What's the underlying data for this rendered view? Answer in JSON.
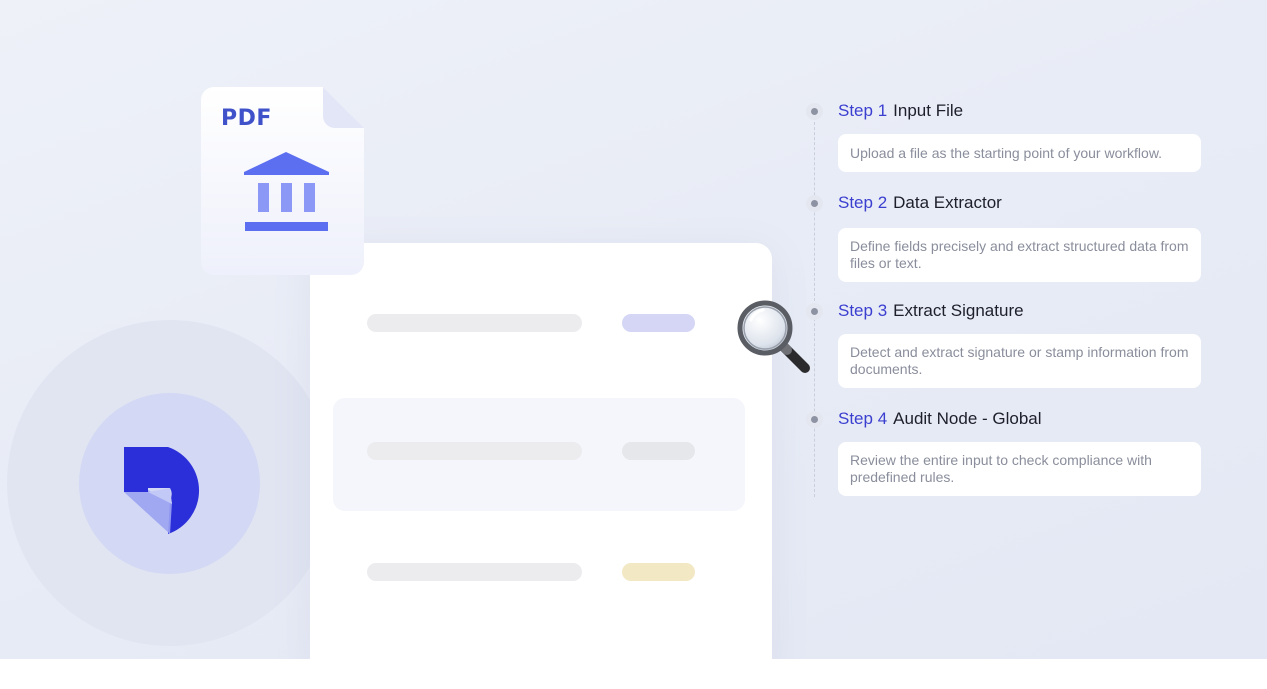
{
  "document": {
    "type_label": "PDF",
    "icon": "bank-building-icon"
  },
  "logo": {
    "icon": "brand-logo-icon"
  },
  "magnifier": {
    "icon": "magnifying-glass-icon"
  },
  "steps": [
    {
      "number": "Step 1",
      "name": "Input File",
      "description": "Upload a file as the starting point of your workflow."
    },
    {
      "number": "Step 2",
      "name": "Data Extractor",
      "description": "Define fields precisely and extract structured data from files or text."
    },
    {
      "number": "Step 3",
      "name": "Extract Signature",
      "description": "Detect and extract signature or stamp information from documents."
    },
    {
      "number": "Step 4",
      "name": "Audit Node - Global",
      "description": "Review the entire input to check compliance with predefined rules."
    }
  ],
  "colors": {
    "accent": "#3b3fd0",
    "brand_logo": "#2b2fd9",
    "pdf_label": "#3f52c9",
    "bank_icon": "#5b6ff0",
    "pill_purple": "#d5d6f6",
    "pill_gray": "#e6e7ea",
    "pill_yellow": "#f2e8c3"
  }
}
